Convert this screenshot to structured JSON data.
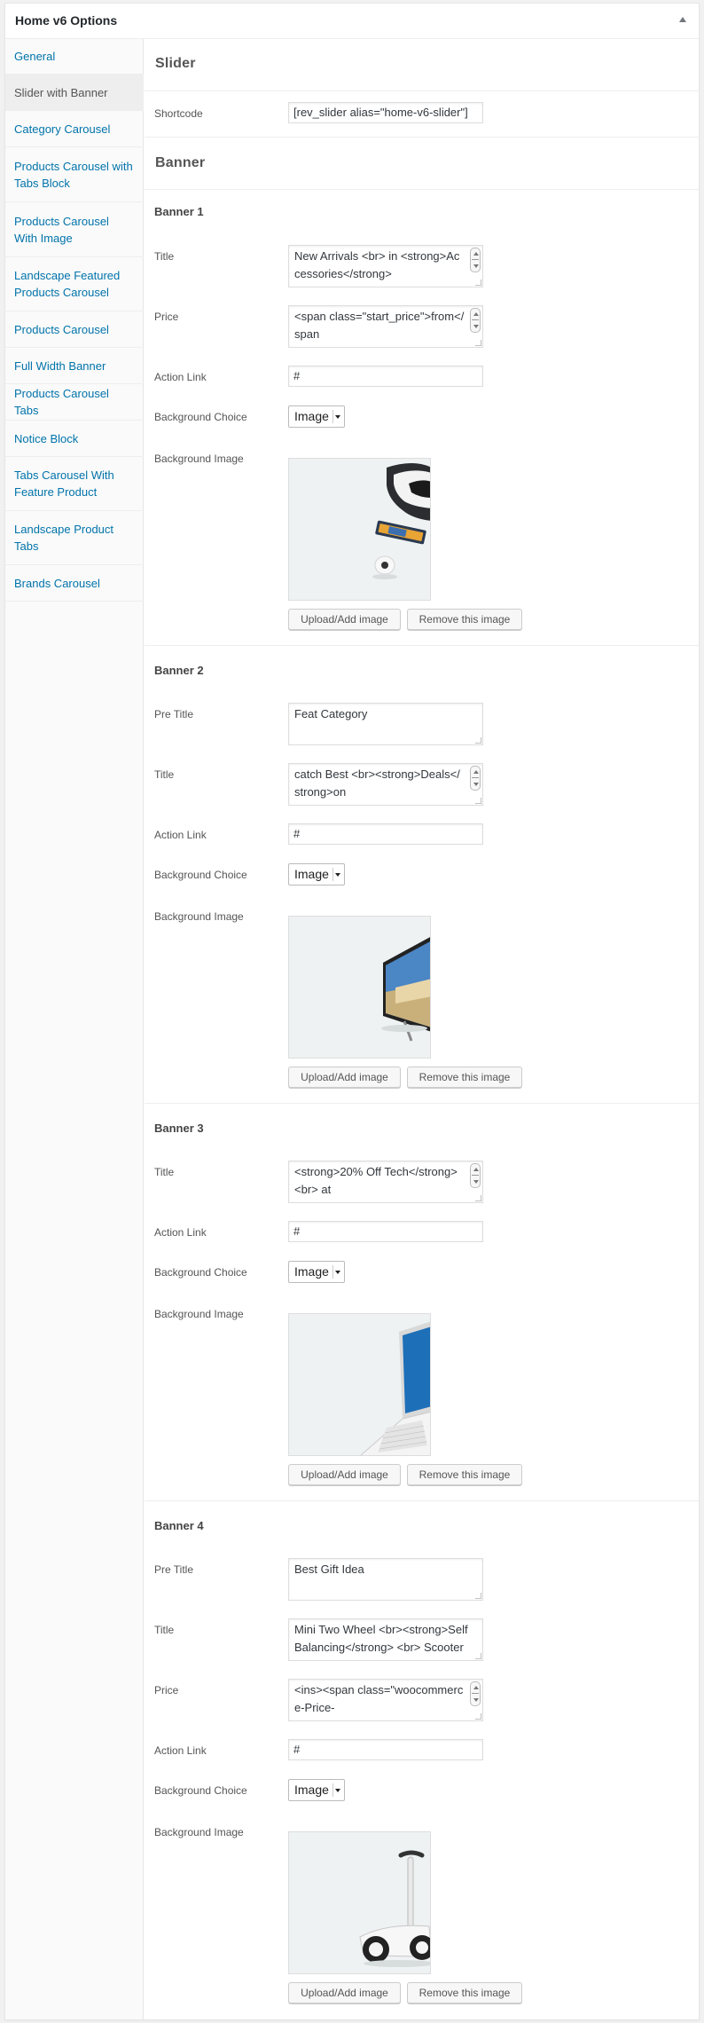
{
  "panel": {
    "title": "Home v6 Options"
  },
  "sidebar": {
    "items": [
      {
        "label": "General"
      },
      {
        "label": "Slider with Banner"
      },
      {
        "label": "Category Carousel"
      },
      {
        "label": "Products Carousel with Tabs Block"
      },
      {
        "label": "Products Carousel With Image"
      },
      {
        "label": "Landscape Featured Products Carousel"
      },
      {
        "label": "Products Carousel"
      },
      {
        "label": "Full Width Banner"
      },
      {
        "label": "Products Carousel Tabs"
      },
      {
        "label": "Notice Block"
      },
      {
        "label": "Tabs Carousel With Feature Product"
      },
      {
        "label": "Landscape Product Tabs"
      },
      {
        "label": "Brands Carousel"
      }
    ]
  },
  "slider": {
    "heading": "Slider",
    "shortcode_label": "Shortcode",
    "shortcode_value": "[rev_slider alias=\"home-v6-slider\"]"
  },
  "banner_section": {
    "heading": "Banner"
  },
  "labels": {
    "pre_title": "Pre Title",
    "title": "Title",
    "price": "Price",
    "action_link": "Action Link",
    "background_choice": "Background Choice",
    "background_image": "Background Image",
    "upload": "Upload/Add image",
    "remove": "Remove this image"
  },
  "banners": [
    {
      "heading": "Banner 1",
      "title": "New Arrivals <br> in <strong>Accessories</strong>",
      "price": "<span class=\"start_price\">from</span",
      "action_link": "#",
      "background_choice": "Image"
    },
    {
      "heading": "Banner 2",
      "pre_title": "Feat Category",
      "title": "catch Best <br><strong>Deals</strong>on",
      "action_link": "#",
      "background_choice": "Image"
    },
    {
      "heading": "Banner 3",
      "title": "<strong>20% Off Tech</strong> <br> at",
      "action_link": "#",
      "background_choice": "Image"
    },
    {
      "heading": "Banner 4",
      "pre_title": "Best Gift Idea",
      "title": "Mini Two Wheel <br><strong>Self Balancing</strong> <br> Scooter",
      "price": "<ins><span class=\"woocommerce-Price-",
      "action_link": "#",
      "background_choice": "Image"
    }
  ]
}
